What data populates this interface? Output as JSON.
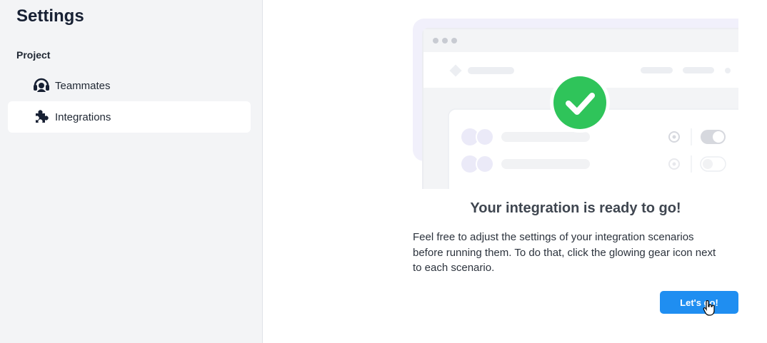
{
  "sidebar": {
    "title": "Settings",
    "section_label": "Project",
    "items": [
      {
        "label": "Teammates",
        "icon": "headset-icon",
        "active": false
      },
      {
        "label": "Integrations",
        "icon": "puzzle-icon",
        "active": true
      }
    ]
  },
  "main": {
    "illustration_icon": "check-circle-icon",
    "heading": "Your integration is ready to go!",
    "body": "Feel free to adjust the settings of your integration scenarios before running them. To do that, click the glowing gear icon next to each scenario.",
    "cta_label": "Let's go!"
  },
  "colors": {
    "accent": "#1f8ef1",
    "success": "#2fc45a",
    "sidebar_bg": "#f3f4f6"
  }
}
